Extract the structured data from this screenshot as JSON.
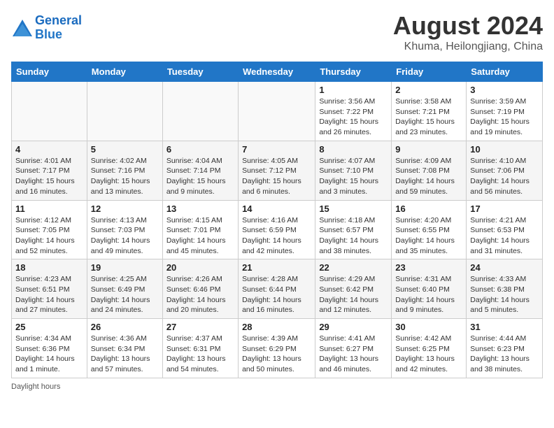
{
  "header": {
    "logo_line1": "General",
    "logo_line2": "Blue",
    "month": "August 2024",
    "location": "Khuma, Heilongjiang, China"
  },
  "days_of_week": [
    "Sunday",
    "Monday",
    "Tuesday",
    "Wednesday",
    "Thursday",
    "Friday",
    "Saturday"
  ],
  "weeks": [
    [
      {
        "day": "",
        "info": ""
      },
      {
        "day": "",
        "info": ""
      },
      {
        "day": "",
        "info": ""
      },
      {
        "day": "",
        "info": ""
      },
      {
        "day": "1",
        "info": "Sunrise: 3:56 AM\nSunset: 7:22 PM\nDaylight: 15 hours\nand 26 minutes."
      },
      {
        "day": "2",
        "info": "Sunrise: 3:58 AM\nSunset: 7:21 PM\nDaylight: 15 hours\nand 23 minutes."
      },
      {
        "day": "3",
        "info": "Sunrise: 3:59 AM\nSunset: 7:19 PM\nDaylight: 15 hours\nand 19 minutes."
      }
    ],
    [
      {
        "day": "4",
        "info": "Sunrise: 4:01 AM\nSunset: 7:17 PM\nDaylight: 15 hours\nand 16 minutes."
      },
      {
        "day": "5",
        "info": "Sunrise: 4:02 AM\nSunset: 7:16 PM\nDaylight: 15 hours\nand 13 minutes."
      },
      {
        "day": "6",
        "info": "Sunrise: 4:04 AM\nSunset: 7:14 PM\nDaylight: 15 hours\nand 9 minutes."
      },
      {
        "day": "7",
        "info": "Sunrise: 4:05 AM\nSunset: 7:12 PM\nDaylight: 15 hours\nand 6 minutes."
      },
      {
        "day": "8",
        "info": "Sunrise: 4:07 AM\nSunset: 7:10 PM\nDaylight: 15 hours\nand 3 minutes."
      },
      {
        "day": "9",
        "info": "Sunrise: 4:09 AM\nSunset: 7:08 PM\nDaylight: 14 hours\nand 59 minutes."
      },
      {
        "day": "10",
        "info": "Sunrise: 4:10 AM\nSunset: 7:06 PM\nDaylight: 14 hours\nand 56 minutes."
      }
    ],
    [
      {
        "day": "11",
        "info": "Sunrise: 4:12 AM\nSunset: 7:05 PM\nDaylight: 14 hours\nand 52 minutes."
      },
      {
        "day": "12",
        "info": "Sunrise: 4:13 AM\nSunset: 7:03 PM\nDaylight: 14 hours\nand 49 minutes."
      },
      {
        "day": "13",
        "info": "Sunrise: 4:15 AM\nSunset: 7:01 PM\nDaylight: 14 hours\nand 45 minutes."
      },
      {
        "day": "14",
        "info": "Sunrise: 4:16 AM\nSunset: 6:59 PM\nDaylight: 14 hours\nand 42 minutes."
      },
      {
        "day": "15",
        "info": "Sunrise: 4:18 AM\nSunset: 6:57 PM\nDaylight: 14 hours\nand 38 minutes."
      },
      {
        "day": "16",
        "info": "Sunrise: 4:20 AM\nSunset: 6:55 PM\nDaylight: 14 hours\nand 35 minutes."
      },
      {
        "day": "17",
        "info": "Sunrise: 4:21 AM\nSunset: 6:53 PM\nDaylight: 14 hours\nand 31 minutes."
      }
    ],
    [
      {
        "day": "18",
        "info": "Sunrise: 4:23 AM\nSunset: 6:51 PM\nDaylight: 14 hours\nand 27 minutes."
      },
      {
        "day": "19",
        "info": "Sunrise: 4:25 AM\nSunset: 6:49 PM\nDaylight: 14 hours\nand 24 minutes."
      },
      {
        "day": "20",
        "info": "Sunrise: 4:26 AM\nSunset: 6:46 PM\nDaylight: 14 hours\nand 20 minutes."
      },
      {
        "day": "21",
        "info": "Sunrise: 4:28 AM\nSunset: 6:44 PM\nDaylight: 14 hours\nand 16 minutes."
      },
      {
        "day": "22",
        "info": "Sunrise: 4:29 AM\nSunset: 6:42 PM\nDaylight: 14 hours\nand 12 minutes."
      },
      {
        "day": "23",
        "info": "Sunrise: 4:31 AM\nSunset: 6:40 PM\nDaylight: 14 hours\nand 9 minutes."
      },
      {
        "day": "24",
        "info": "Sunrise: 4:33 AM\nSunset: 6:38 PM\nDaylight: 14 hours\nand 5 minutes."
      }
    ],
    [
      {
        "day": "25",
        "info": "Sunrise: 4:34 AM\nSunset: 6:36 PM\nDaylight: 14 hours\nand 1 minute."
      },
      {
        "day": "26",
        "info": "Sunrise: 4:36 AM\nSunset: 6:34 PM\nDaylight: 13 hours\nand 57 minutes."
      },
      {
        "day": "27",
        "info": "Sunrise: 4:37 AM\nSunset: 6:31 PM\nDaylight: 13 hours\nand 54 minutes."
      },
      {
        "day": "28",
        "info": "Sunrise: 4:39 AM\nSunset: 6:29 PM\nDaylight: 13 hours\nand 50 minutes."
      },
      {
        "day": "29",
        "info": "Sunrise: 4:41 AM\nSunset: 6:27 PM\nDaylight: 13 hours\nand 46 minutes."
      },
      {
        "day": "30",
        "info": "Sunrise: 4:42 AM\nSunset: 6:25 PM\nDaylight: 13 hours\nand 42 minutes."
      },
      {
        "day": "31",
        "info": "Sunrise: 4:44 AM\nSunset: 6:23 PM\nDaylight: 13 hours\nand 38 minutes."
      }
    ]
  ],
  "footer": {
    "note": "Daylight hours"
  }
}
